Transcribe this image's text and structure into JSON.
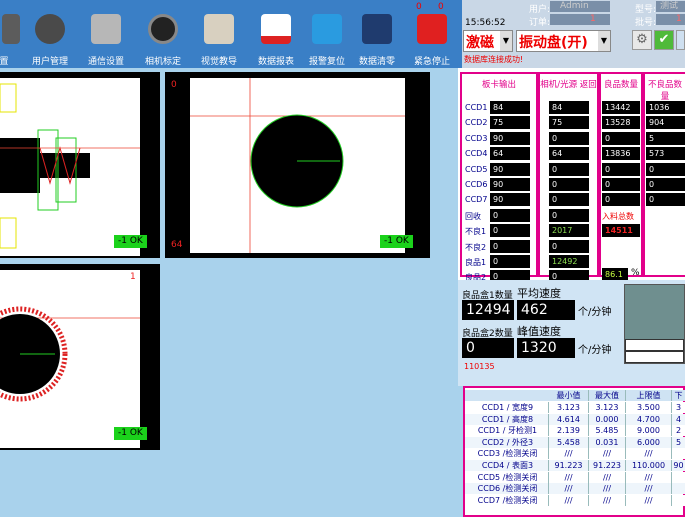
{
  "toolbar": {
    "items": [
      {
        "label": "置",
        "icon": "tools-icon"
      },
      {
        "label": "用户管理",
        "icon": "users-icon"
      },
      {
        "label": "通信设置",
        "icon": "server-icon"
      },
      {
        "label": "相机标定",
        "icon": "camera-icon"
      },
      {
        "label": "视觉教导",
        "icon": "vision-teach-icon"
      },
      {
        "label": "数据报表",
        "icon": "report-icon"
      },
      {
        "label": "报警复位",
        "icon": "alarm-reset-icon"
      },
      {
        "label": "数据清零",
        "icon": "calculator-icon"
      },
      {
        "label": "紧急停止",
        "icon": "emergency-stop-icon"
      }
    ],
    "stop_counts": [
      "0",
      "0"
    ]
  },
  "control": {
    "time": "15:56:52",
    "user_label": "用户:",
    "user_value": "Admin",
    "order_label": "订单:",
    "order_value": "1",
    "model_label": "型号:",
    "model_value": "测试",
    "batch_label": "批号:",
    "batch_value": "1",
    "excitation_select": "激磁",
    "vibration_select": "振动盘(开)",
    "status_message": "数据库连接成功!"
  },
  "viewports": [
    {
      "result": "-1  OK",
      "index": ""
    },
    {
      "result": "-1  OK",
      "index": "0",
      "corner": "64"
    },
    {
      "result": "-1  OK",
      "index": "1"
    }
  ],
  "grid": {
    "headers": [
      "板卡输出",
      "相机/光源 返回",
      "良品数量",
      "不良品数量"
    ],
    "row_labels": [
      "CCD1",
      "CCD2",
      "CCD3",
      "CCD4",
      "CCD5",
      "CCD6",
      "CCD7",
      "回收",
      "不良1",
      "不良2",
      "良品1",
      "良品2"
    ],
    "board_output": [
      "84",
      "75",
      "90",
      "64",
      "90",
      "90",
      "90",
      "0",
      "0",
      "0",
      "0",
      "0"
    ],
    "camera_return": [
      "84",
      "75",
      "0",
      "64",
      "0",
      "0",
      "0",
      "0",
      "2017",
      "0",
      "12492",
      "0"
    ],
    "good_count": [
      "13442",
      "13528",
      "0",
      "13836",
      "0",
      "0",
      "0"
    ],
    "bad_count": [
      "1036",
      "904",
      "5",
      "573",
      "0",
      "0",
      "0"
    ],
    "total_label": "入料总数",
    "total_value": "14511",
    "rate_value": "86.1",
    "rate_unit": "%"
  },
  "stats": {
    "box1_label": "良品盒1数量",
    "box1_value": "12494",
    "avg_label": "平均速度",
    "avg_value": "462",
    "unit": "个/分钟",
    "box2_label": "良品盒2数量",
    "box2_value": "0",
    "peak_label": "峰值速度",
    "peak_value": "1320",
    "unit2": "个/分钟",
    "code": "110135"
  },
  "table": {
    "headers": [
      "最小值",
      "最大值",
      "上限值",
      "下"
    ],
    "rows": [
      {
        "name": "CCD1 / 宽度9",
        "min": "3.123",
        "max": "3.123",
        "upper": "3.500",
        "extra": "3"
      },
      {
        "name": "CCD1 / 高度8",
        "min": "4.614",
        "max": "0.000",
        "upper": "4.700",
        "extra": "4"
      },
      {
        "name": "CCD1 / 牙检测1",
        "min": "2.139",
        "max": "5.485",
        "upper": "9.000",
        "extra": "2"
      },
      {
        "name": "CCD2 / 外径3",
        "min": "5.458",
        "max": "0.031",
        "upper": "6.000",
        "extra": "5"
      },
      {
        "name": "CCD3 /检测关闭",
        "min": "///",
        "max": "///",
        "upper": "///",
        "extra": ""
      },
      {
        "name": "CCD4 / 表面3",
        "min": "91.223",
        "max": "91.223",
        "upper": "110.000",
        "extra": "90"
      },
      {
        "name": "CCD5 /检测关闭",
        "min": "///",
        "max": "///",
        "upper": "///",
        "extra": ""
      },
      {
        "name": "CCD6 /检测关闭",
        "min": "///",
        "max": "///",
        "upper": "///",
        "extra": ""
      },
      {
        "name": "CCD7 /检测关闭",
        "min": "///",
        "max": "///",
        "upper": "///",
        "extra": ""
      }
    ]
  },
  "colors": {
    "accent": "#e2008a",
    "ok": "#1bd21b",
    "toolbar": "#3a7fc6",
    "background": "#a9d2ec"
  }
}
